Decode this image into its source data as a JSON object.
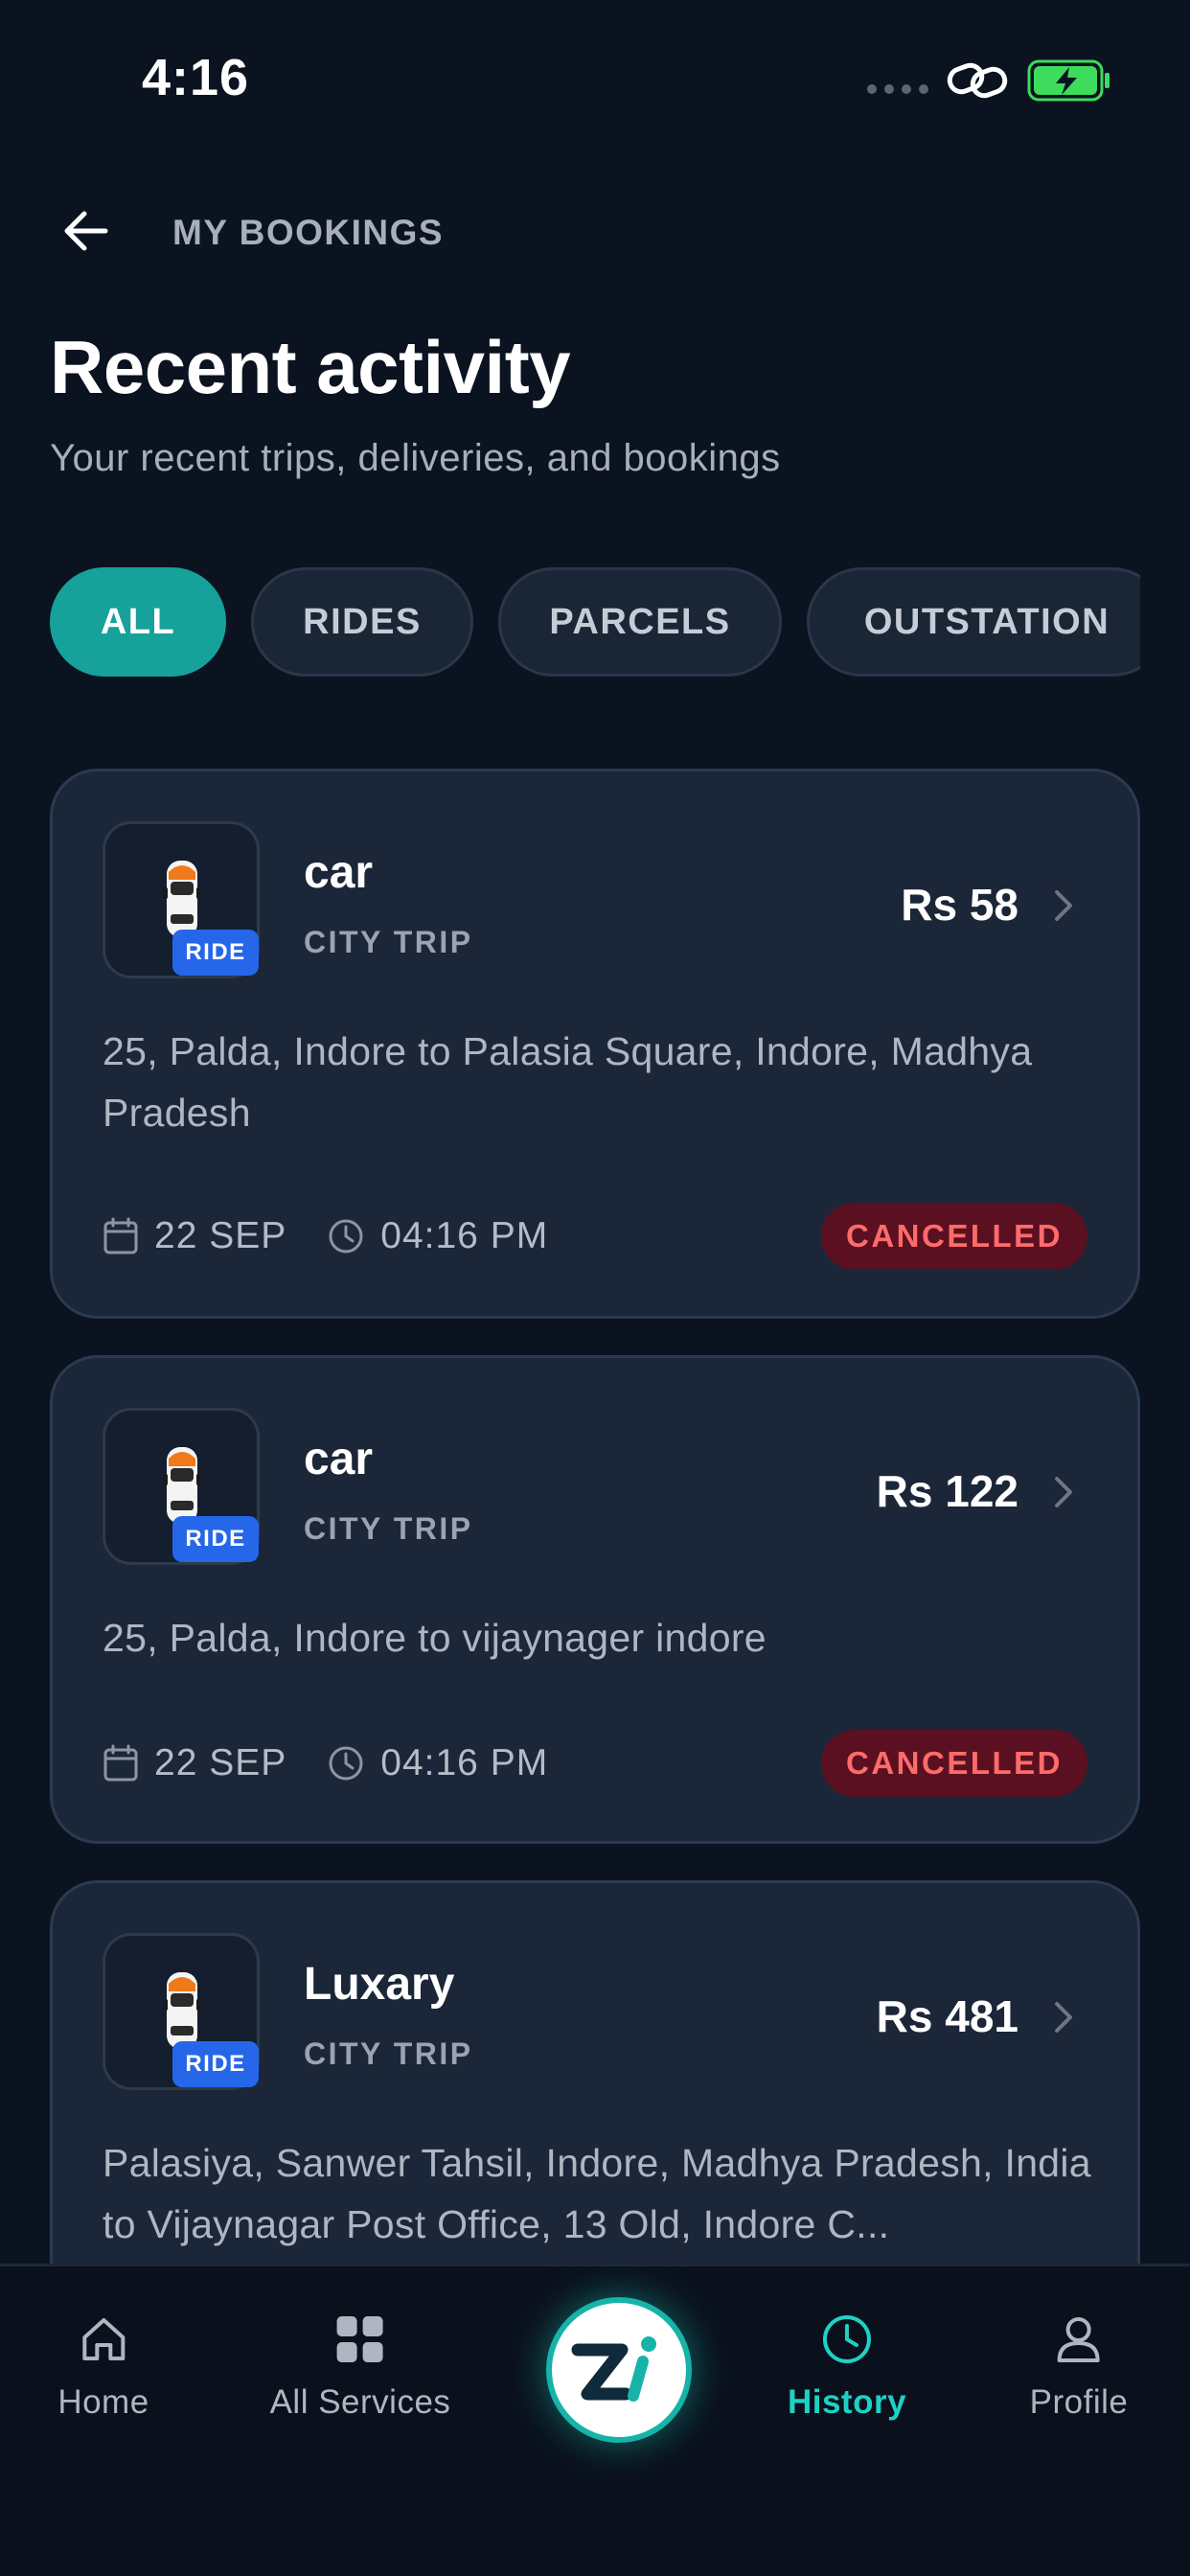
{
  "status_bar": {
    "time": "4:16"
  },
  "header": {
    "back_icon": "arrow-left-icon",
    "label": "MY BOOKINGS"
  },
  "page": {
    "title": "Recent activity",
    "subtitle": "Your recent trips, deliveries, and bookings"
  },
  "filters": [
    {
      "label": "ALL",
      "active": true
    },
    {
      "label": "RIDES",
      "active": false
    },
    {
      "label": "PARCELS",
      "active": false
    },
    {
      "label": "OUTSTATION",
      "active": false
    }
  ],
  "bookings": [
    {
      "tag": "RIDE",
      "vehicle": "car",
      "trip_type": "CITY TRIP",
      "price": "Rs 58",
      "address": "25, Palda, Indore to Palasia Square, Indore, Madhya Pradesh",
      "date": "22 SEP",
      "time": "04:16 PM",
      "status": "CANCELLED"
    },
    {
      "tag": "RIDE",
      "vehicle": "car",
      "trip_type": "CITY TRIP",
      "price": "Rs 122",
      "address": "25, Palda, Indore to vijaynager indore",
      "date": "22 SEP",
      "time": "04:16 PM",
      "status": "CANCELLED"
    },
    {
      "tag": "RIDE",
      "vehicle": "Luxary",
      "trip_type": "CITY TRIP",
      "price": "Rs 481",
      "address": "Palasiya, Sanwer Tahsil, Indore, Madhya Pradesh, India to Vijaynagar Post Office, 13 Old, Indore C..."
    }
  ],
  "nav": [
    {
      "label": "Home",
      "icon": "home-icon",
      "active": false
    },
    {
      "label": "All Services",
      "icon": "grid-icon",
      "active": false
    },
    {
      "label": "Zi",
      "icon": "zi-logo",
      "active": false
    },
    {
      "label": "History",
      "icon": "clock-icon",
      "active": true
    },
    {
      "label": "Profile",
      "icon": "user-icon",
      "active": false
    }
  ],
  "colors": {
    "background": "#0b1320",
    "card": "#1b2638",
    "accent": "#16a19a",
    "active_nav": "#1fd1c4",
    "ride_tag": "#2567e8",
    "cancelled_bg": "#5a1020",
    "cancelled_text": "#ff6b6b"
  }
}
